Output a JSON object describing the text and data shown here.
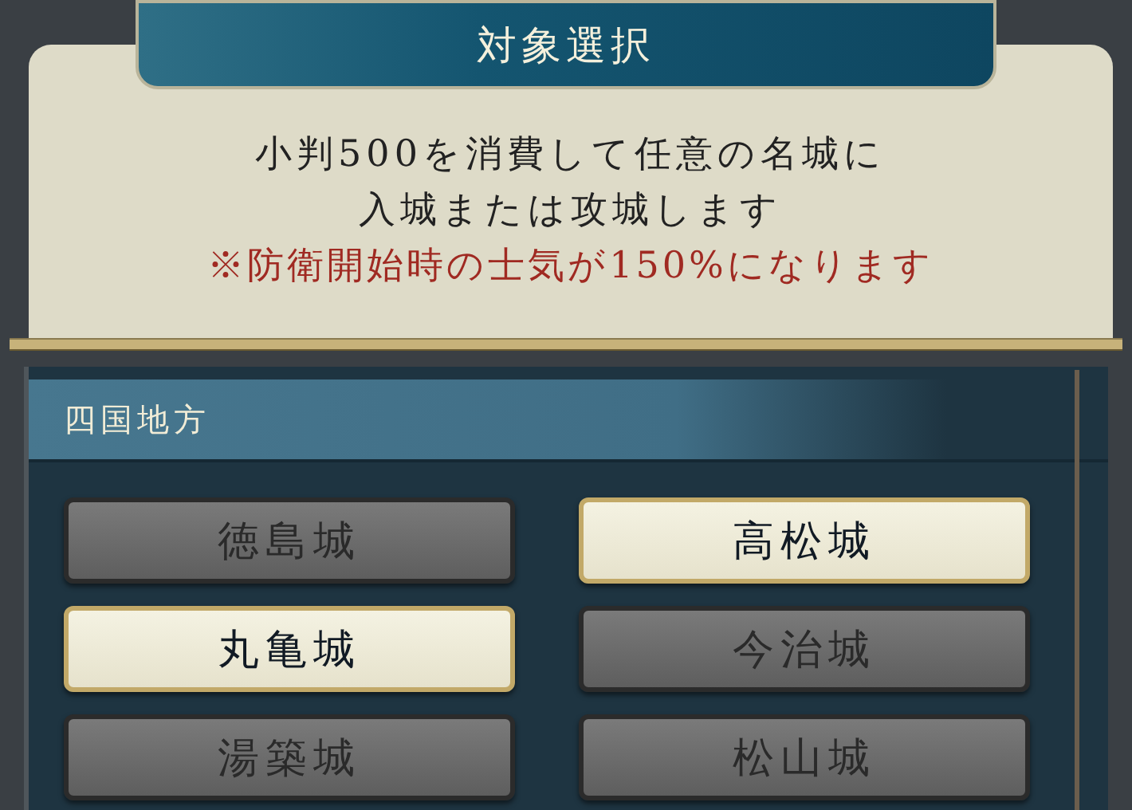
{
  "dialog": {
    "title": "対象選択",
    "description": [
      "小判500を消費して任意の名城に",
      "入城または攻城します"
    ],
    "note": "※防衛開始時の士気が150%になります"
  },
  "region": {
    "title": "四国地方",
    "castles": [
      {
        "label": "徳島城",
        "disabled": true
      },
      {
        "label": "高松城",
        "disabled": false
      },
      {
        "label": "丸亀城",
        "disabled": false
      },
      {
        "label": "今治城",
        "disabled": true
      },
      {
        "label": "湯築城",
        "disabled": true
      },
      {
        "label": "松山城",
        "disabled": true
      }
    ]
  }
}
